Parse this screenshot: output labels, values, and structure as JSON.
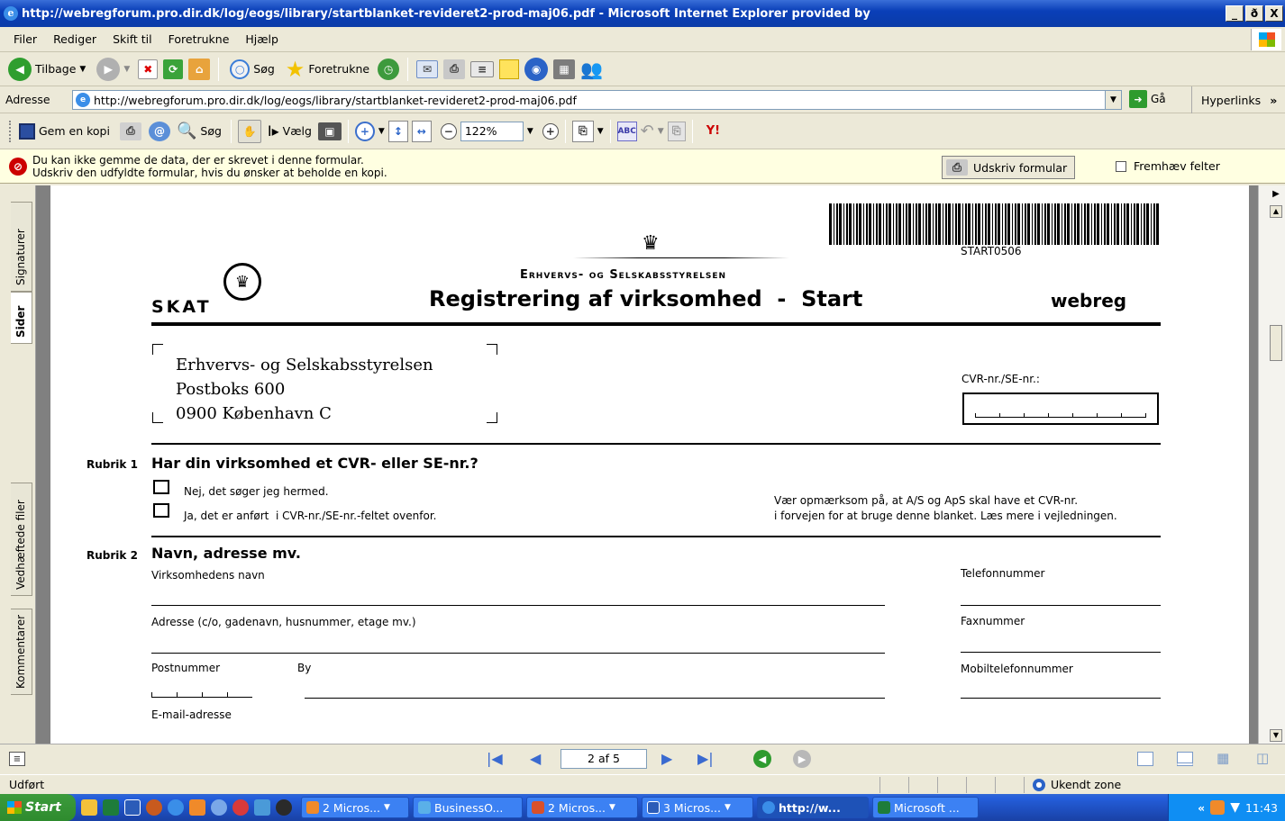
{
  "window": {
    "title": "http://webregforum.pro.dir.dk/log/eogs/library/startblanket-revideret2-prod-maj06.pdf - Microsoft Internet Explorer provided by",
    "min": "_",
    "restore": "ð",
    "close": "X"
  },
  "menu": [
    "Filer",
    "Rediger",
    "Skift til",
    "Foretrukne",
    "Hjælp"
  ],
  "nav": {
    "back": "Tilbage",
    "search": "Søg",
    "favorites": "Foretrukne"
  },
  "address": {
    "label": "Adresse",
    "url": "http://webregforum.pro.dir.dk/log/eogs/library/startblanket-revideret2-prod-maj06.pdf",
    "go": "Gå",
    "links": "Hyperlinks",
    "more": "»"
  },
  "pdf_toolbar": {
    "save_copy": "Gem en kopi",
    "search": "Søg",
    "select": "Vælg",
    "zoom": "122%",
    "yahoo": "Y!"
  },
  "message": {
    "line1": "Du kan ikke gemme de data, der er skrevet i denne formular.",
    "line2": "Udskriv den udfyldte formular, hvis du ønsker at beholde en kopi.",
    "print_btn": "Udskriv formular",
    "highlight": "Fremhæv felter"
  },
  "side_tabs": {
    "signatures": "Signaturer",
    "pages": "Sider",
    "attachments": "Vedhæftede filer",
    "comments": "Kommentarer"
  },
  "form": {
    "barcode_text": "START0506",
    "agency": "Erhvervs- og Selskabsstyrelsen",
    "skat": "SKAT",
    "title": "Registrering af virksomhed  -  Start",
    "webreg": "webreg",
    "address_lines": [
      "Erhvervs- og Selskabsstyrelsen",
      "Postboks 600",
      "0900 København C"
    ],
    "cvr_label": "CVR-nr./SE-nr.:",
    "rubrik1": {
      "num": "Rubrik 1",
      "title": "Har din virksomhed et CVR- eller SE-nr.?",
      "opt1": "Nej, det søger jeg hermed.",
      "opt2": "Ja, det er anført  i CVR-nr./SE-nr.-feltet ovenfor.",
      "note1": "Vær opmærksom på, at A/S og ApS skal have et CVR-nr.",
      "note2": "i forvejen for at bruge denne blanket. Læs mere i vejledningen."
    },
    "rubrik2": {
      "num": "Rubrik 2",
      "title": "Navn, adresse mv.",
      "name": "Virksomhedens navn",
      "phone": "Telefonnummer",
      "address": "Adresse (c/o, gadenavn, husnummer, etage mv.)",
      "fax": "Faxnummer",
      "postal": "Postnummer",
      "city": "By",
      "mobile": "Mobiltelefonnummer",
      "email": "E-mail-adresse"
    }
  },
  "pager": {
    "page": "2 af 5"
  },
  "status": {
    "left": "Udført",
    "zone": "Ukendt zone"
  },
  "taskbar": {
    "start": "Start",
    "tasks": [
      "2 Micros...",
      "BusinessO...",
      "2 Micros...",
      "3 Micros...",
      "http://w...",
      "Microsoft ..."
    ],
    "tray_arrow": "«",
    "clock": "11:43"
  }
}
